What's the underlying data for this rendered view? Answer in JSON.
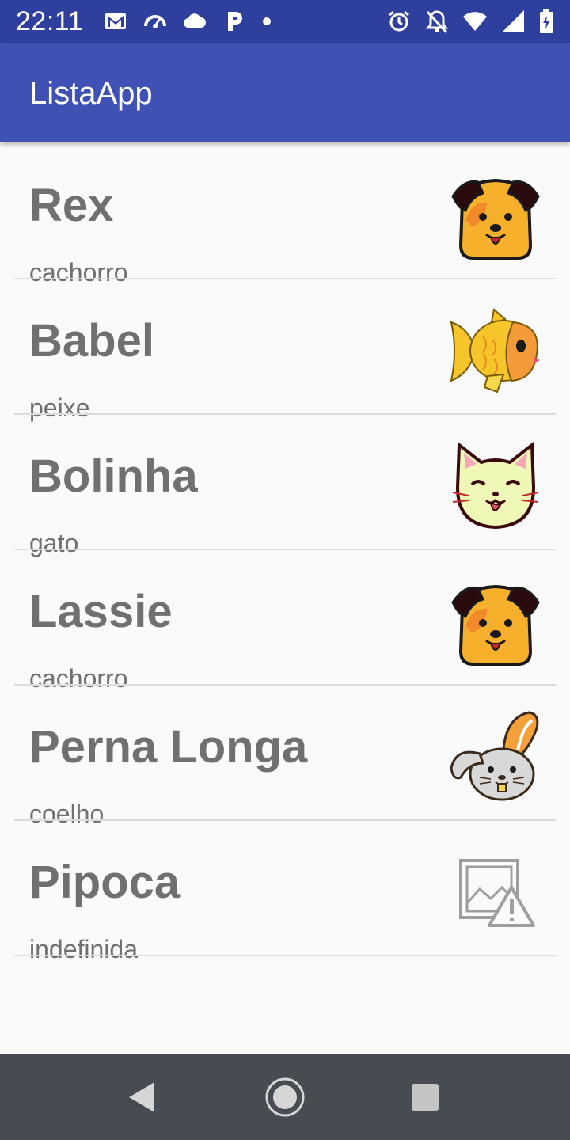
{
  "status_bar": {
    "time": "22:11",
    "left_icons": [
      "gmail-icon",
      "speed-icon",
      "cloud-icon",
      "parking-icon",
      "dot-icon"
    ],
    "right_icons": [
      "alarm-icon",
      "notifications-off-icon",
      "wifi-icon",
      "signal-icon",
      "battery-icon"
    ]
  },
  "app_bar": {
    "title": "ListaApp",
    "color": "#3f51b5"
  },
  "list": {
    "items": [
      {
        "name": "Rex",
        "type": "cachorro",
        "icon": "dog-icon"
      },
      {
        "name": "Babel",
        "type": "peixe",
        "icon": "fish-icon"
      },
      {
        "name": "Bolinha",
        "type": "gato",
        "icon": "cat-icon"
      },
      {
        "name": "Lassie",
        "type": "cachorro",
        "icon": "dog-icon"
      },
      {
        "name": "Perna Longa",
        "type": "coelho",
        "icon": "rabbit-icon"
      },
      {
        "name": "Pipoca",
        "type": "indefinida",
        "icon": "broken-image-icon"
      }
    ]
  },
  "nav_bar": {
    "buttons": [
      "back-icon",
      "home-icon",
      "recents-icon"
    ]
  }
}
